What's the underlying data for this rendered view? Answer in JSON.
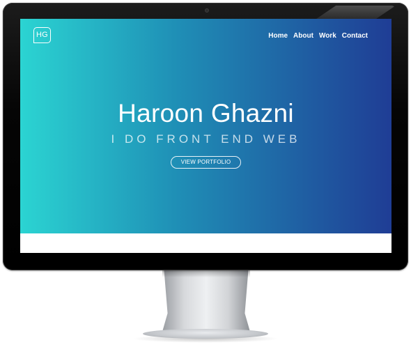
{
  "site": {
    "logo_text": "HG",
    "nav": [
      {
        "label": "Home"
      },
      {
        "label": "About"
      },
      {
        "label": "Work"
      },
      {
        "label": "Contact"
      }
    ],
    "hero": {
      "name": "Haroon Ghazni",
      "tagline": "I DO FRONT END WEB",
      "cta_label": "VIEW PORTFOLIO"
    }
  },
  "colors": {
    "gradient_start": "#2bd4d2",
    "gradient_end": "#1f3d95",
    "text": "#ffffff",
    "bezel": "#000000"
  }
}
